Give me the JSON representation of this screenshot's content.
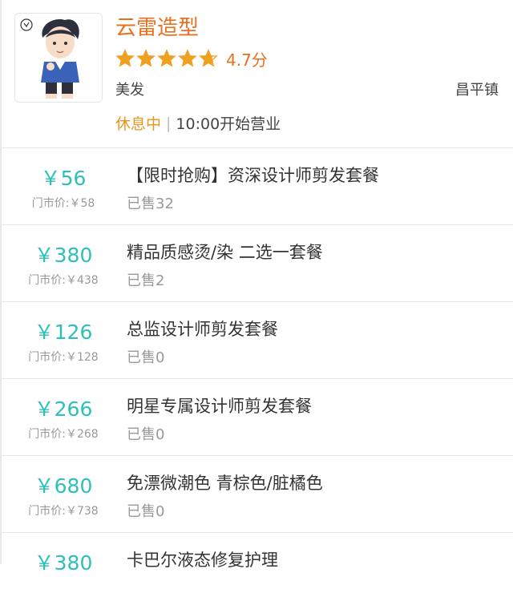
{
  "shop": {
    "name": "云雷造型",
    "rating": 4.7,
    "rating_text": "4.7分",
    "category": "美发",
    "area": "昌平镇",
    "status_state": "休息中",
    "status_sep": "|",
    "status_time": "10:00开始营业"
  },
  "colors": {
    "brand_orange": "#e8701f",
    "status_orange": "#e8951f",
    "price_teal": "#2dbfb8",
    "star_color": "#f0a020"
  },
  "deals": [
    {
      "price": "￥56",
      "orig": "门市价:￥58",
      "title": "【限时抢购】资深设计师剪发套餐",
      "sold": "已售32"
    },
    {
      "price": "￥380",
      "orig": "门市价:￥438",
      "title": "精品质感烫/染 二选一套餐",
      "sold": "已售2"
    },
    {
      "price": "￥126",
      "orig": "门市价:￥128",
      "title": "总监设计师剪发套餐",
      "sold": "已售0"
    },
    {
      "price": "￥266",
      "orig": "门市价:￥268",
      "title": "明星专属设计师剪发套餐",
      "sold": "已售0"
    },
    {
      "price": "￥680",
      "orig": "门市价:￥738",
      "title": "免漂微潮色 青棕色/脏橘色",
      "sold": "已售0"
    },
    {
      "price": "￥380",
      "orig": "",
      "title": "卡巴尔液态修复护理",
      "sold": ""
    }
  ]
}
